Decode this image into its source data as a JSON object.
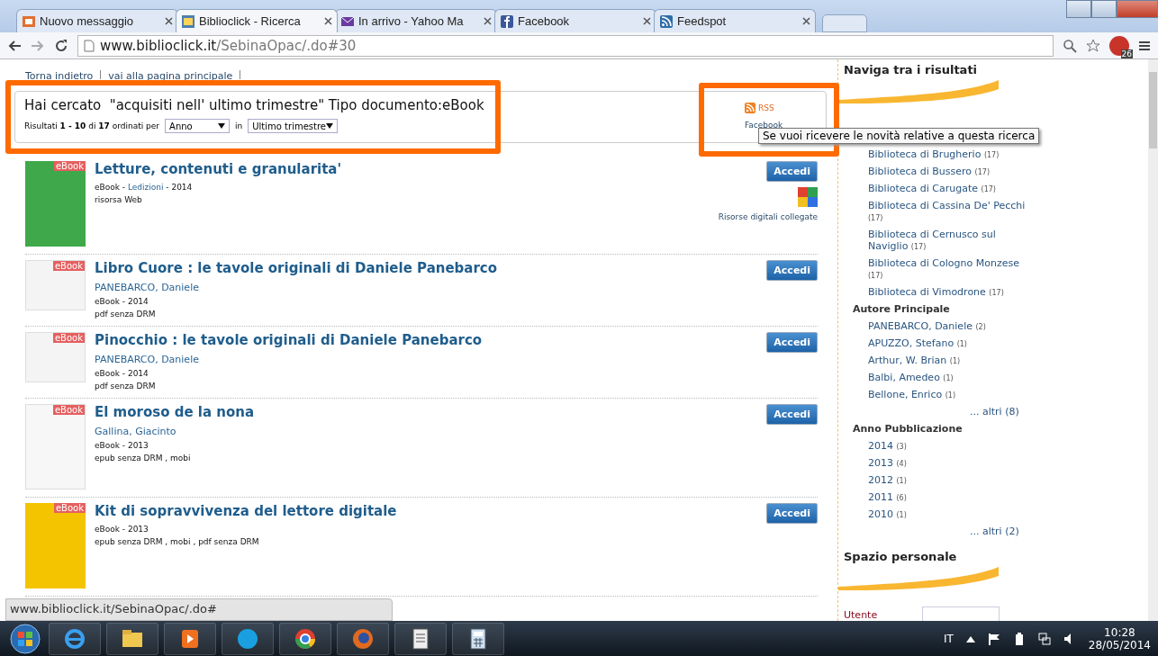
{
  "browser": {
    "tabs": [
      {
        "title": "Nuovo messaggio",
        "selected": false
      },
      {
        "title": "Biblioclick - Ricerca",
        "selected": true
      },
      {
        "title": "In arrivo - Yahoo Ma",
        "selected": false
      },
      {
        "title": "Facebook",
        "selected": false
      },
      {
        "title": "Feedspot",
        "selected": false
      }
    ],
    "url": {
      "host": "www.biblioclick.it",
      "path": "/SebinaOpac/.do#30"
    },
    "abp_count": "26"
  },
  "breadcrumbs": [
    "Torna indietro",
    "vai alla pagina principale"
  ],
  "search": {
    "query": "Hai cercato  \"acquisiti nell' ultimo trimestre\" Tipo documento:eBook",
    "results": "Risultati **1 - 10** di **17** ordinati per",
    "sort": "Anno",
    "in_label": "in",
    "period": "Ultimo trimestre",
    "rss": "RSS",
    "facebook": "Facebook"
  },
  "tooltip": "Se vuoi ricevere le novità relative a questa ricerca",
  "results": [
    {
      "title": "Letture, contenuti e granularita'",
      "badge": "eBook",
      "meta": [
        {
          "kind": "plain",
          "text": "eBook - "
        },
        {
          "kind": "link",
          "text": "Ledizioni"
        },
        {
          "kind": "plain",
          "text": " - 2014"
        }
      ],
      "format": "risorsa Web",
      "button": "Accedi",
      "linked": "Risorse digitali collegate"
    },
    {
      "title": "Libro Cuore : le tavole originali di Daniele Panebarco",
      "badge": "eBook",
      "author": "PANEBARCO, Daniele",
      "meta": [
        {
          "kind": "plain",
          "text": "eBook - 2014"
        }
      ],
      "format": "pdf senza DRM",
      "button": "Accedi"
    },
    {
      "title": "Pinocchio : le tavole originali di Daniele Panebarco",
      "badge": "eBook",
      "author": "PANEBARCO, Daniele",
      "meta": [
        {
          "kind": "plain",
          "text": "eBook - 2014"
        }
      ],
      "format": "pdf senza DRM",
      "button": "Accedi"
    },
    {
      "title": "El moroso de la nona",
      "badge": "eBook",
      "author": "Gallina, Giacinto",
      "meta": [
        {
          "kind": "plain",
          "text": "eBook - 2013"
        }
      ],
      "format": "epub senza DRM , mobi",
      "button": "Accedi"
    },
    {
      "title": "Kit di sopravvivenza del lettore digitale",
      "badge": "eBook",
      "meta": [
        {
          "kind": "plain",
          "text": "eBook - 2013"
        }
      ],
      "format": "epub senza DRM , mobi , pdf senza DRM",
      "button": "Accedi"
    }
  ],
  "sidebar": {
    "title": "Naviga tra i risultati",
    "groups": [
      {
        "items": [
          {
            "label": "Biblioteca di Brugherio",
            "count": "(17)"
          },
          {
            "label": "Biblioteca di Bussero",
            "count": "(17)"
          },
          {
            "label": "Biblioteca di Carugate",
            "count": "(17)"
          },
          {
            "label": "Biblioteca di Cassina De' Pecchi",
            "count": "(17)"
          },
          {
            "label": "Biblioteca di Cernusco sul Naviglio",
            "count": "(17)"
          },
          {
            "label": "Biblioteca di Cologno Monzese",
            "count": "(17)"
          },
          {
            "label": "Biblioteca di Vimodrone",
            "count": "(17)"
          }
        ]
      },
      {
        "heading": "Autore Principale",
        "items": [
          {
            "label": "PANEBARCO, Daniele",
            "count": "(2)"
          },
          {
            "label": "APUZZO, Stefano",
            "count": "(1)"
          },
          {
            "label": "Arthur, W. Brian",
            "count": "(1)"
          },
          {
            "label": "Balbi, Amedeo",
            "count": "(1)"
          },
          {
            "label": "Bellone, Enrico",
            "count": "(1)"
          }
        ],
        "more": "... altri (8)"
      },
      {
        "heading": "Anno Pubblicazione",
        "items": [
          {
            "label": "2014",
            "count": "(3)"
          },
          {
            "label": "2013",
            "count": "(4)"
          },
          {
            "label": "2012",
            "count": "(1)"
          },
          {
            "label": "2011",
            "count": "(6)"
          },
          {
            "label": "2010",
            "count": "(1)"
          }
        ],
        "more": "... altri (2)"
      }
    ],
    "personal_title": "Spazio personale",
    "user_label": "Utente"
  },
  "status_url": "www.biblioclick.it/SebinaOpac/.do#",
  "taskbar": {
    "apps": [
      {
        "kind": "ie"
      },
      {
        "kind": "folder"
      },
      {
        "kind": "media"
      },
      {
        "kind": "skype"
      },
      {
        "kind": "chrome"
      },
      {
        "kind": "firefox"
      },
      {
        "kind": "document"
      },
      {
        "kind": "calculator"
      }
    ],
    "language": "IT",
    "time": "10:28",
    "date": "28/05/2014"
  }
}
